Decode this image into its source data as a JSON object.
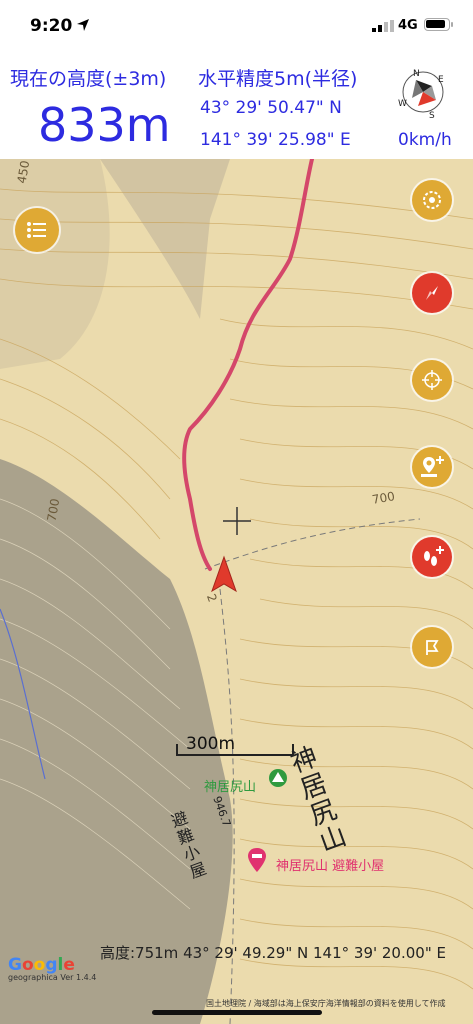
{
  "status": {
    "time": "9:20",
    "network": "4G"
  },
  "info": {
    "altitude_label": "現在の高度(±3m)",
    "altitude_value": "833m",
    "accuracy_label": "水平精度5m(半径)",
    "latitude": "43° 29' 50.47\" N",
    "longitude": "141° 39' 25.98\" E",
    "speed": "0km/h",
    "compass_letters": {
      "n": "N",
      "e": "E",
      "s": "S",
      "w": "W"
    }
  },
  "map": {
    "scale_label": "300m",
    "peak_label": "神居尻山",
    "hut_label": "神居尻山 避難小屋",
    "big_label": "神居尻山",
    "small_label": "避難小屋",
    "elevation_label": "946.7",
    "contour_labels": [
      "450",
      "700",
      "700",
      "2"
    ],
    "bottom_info": "高度:751m  43° 29' 49.29\" N  141° 39' 20.00\" E",
    "attribution": "国土地理院 / 海域部は海上保安庁海洋情報部の資料を使用して作成",
    "google": [
      "G",
      "o",
      "o",
      "g",
      "l",
      "e"
    ],
    "version": "geographica Ver 1.4.4"
  },
  "buttons": {
    "menu": "menu-icon",
    "rotate": "rotate-icon",
    "compass": "compass-needle-icon",
    "locate": "crosshair-icon",
    "add_point": "add-waypoint-icon",
    "record": "footprints-add-icon",
    "flag": "flag-icon"
  },
  "colors": {
    "accent_blue": "#2d2be0",
    "button_gold": "#dfa934",
    "button_red": "#e03a2c",
    "track": "#d4476a",
    "peak_green": "#2f9a3f",
    "hut_pink": "#e0326f"
  }
}
